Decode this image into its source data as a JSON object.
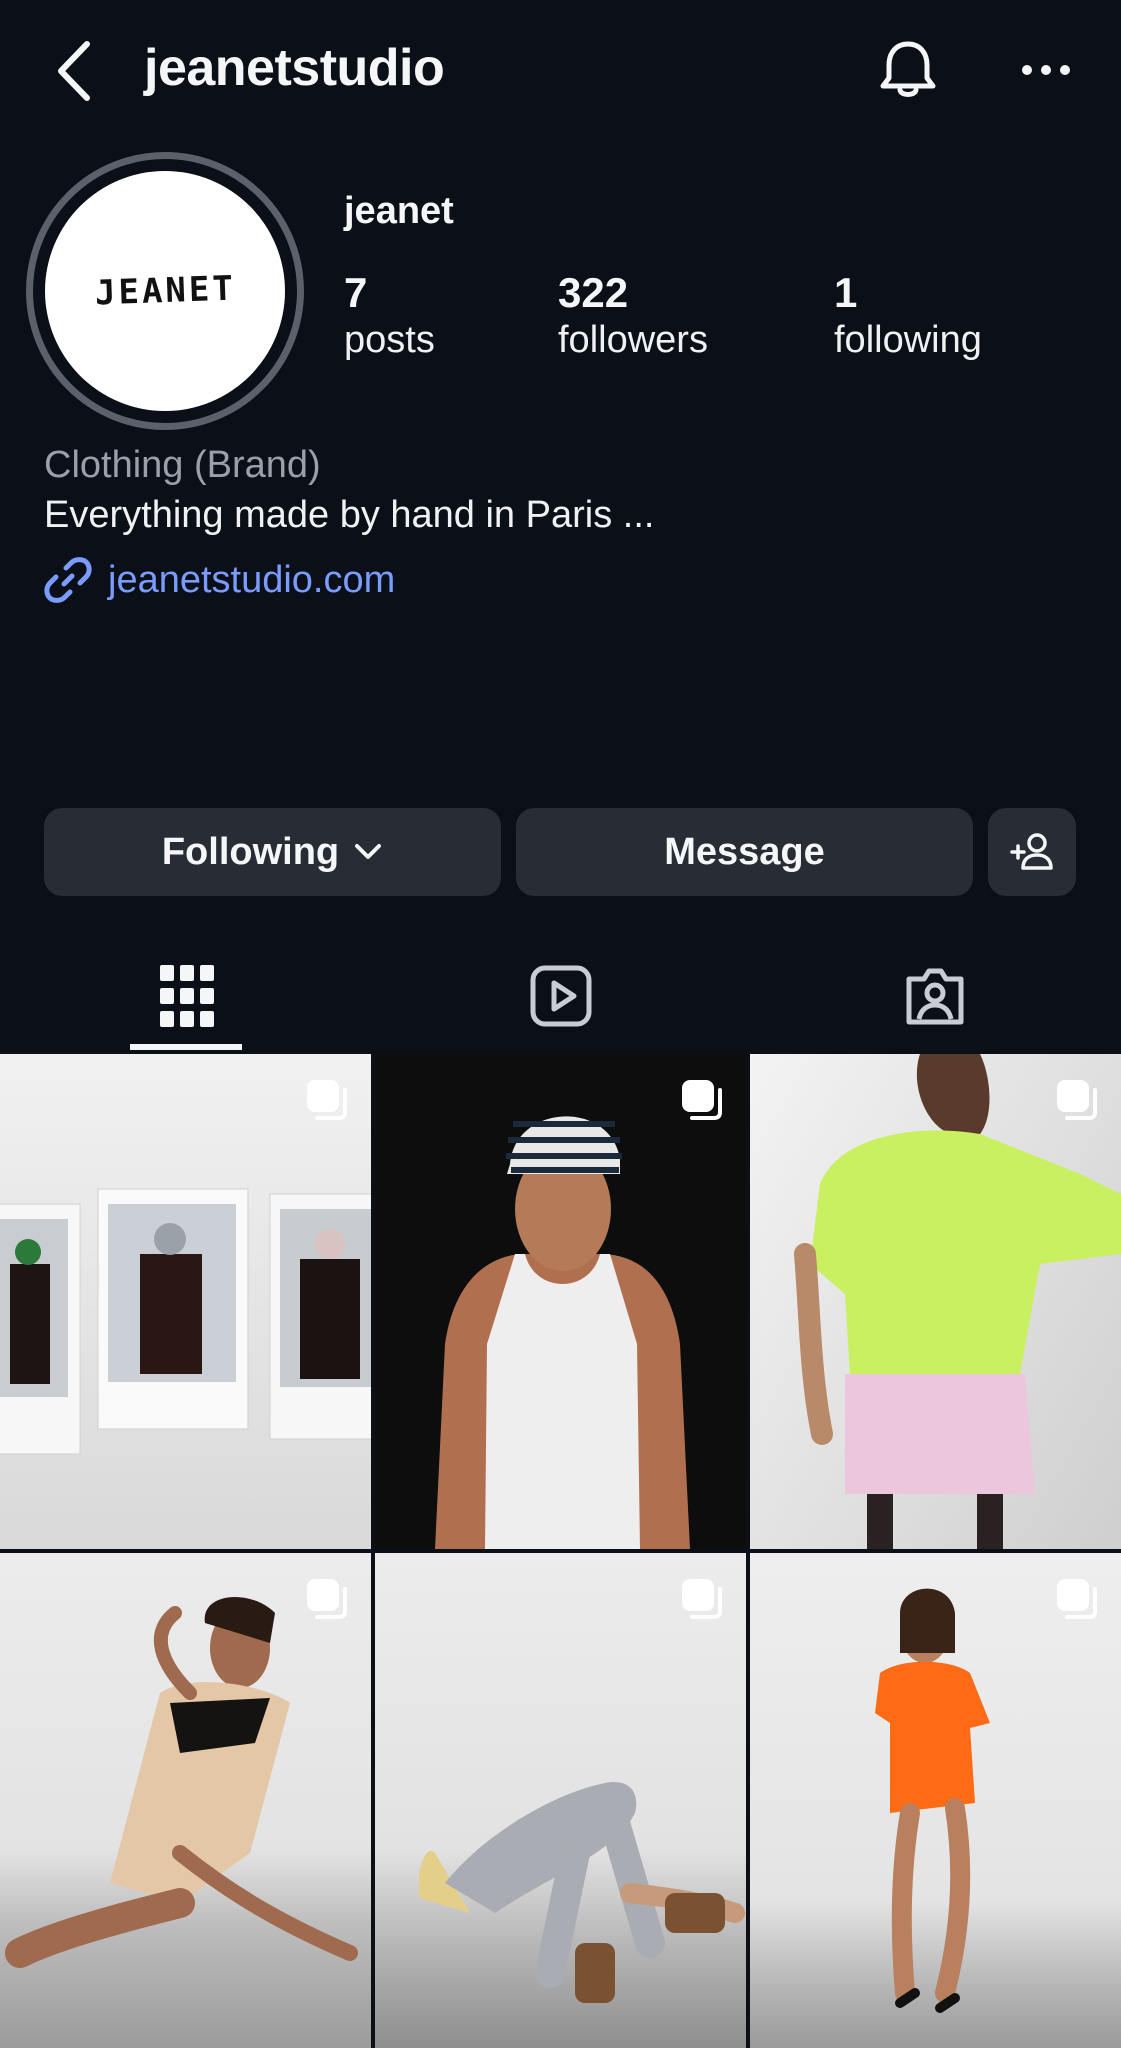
{
  "header": {
    "title": "jeanetstudio",
    "back_icon": "chevron-left-icon",
    "bell_icon": "bell-icon",
    "more_icon": "more-horizontal-icon"
  },
  "profile": {
    "avatar_text": "JEANET",
    "name": "jeanet",
    "stats": [
      {
        "value": "7",
        "label": "posts"
      },
      {
        "value": "322",
        "label": "followers"
      },
      {
        "value": "1",
        "label": "following"
      }
    ],
    "category": "Clothing (Brand)",
    "bio": "Everything made by hand in Paris ...",
    "link": "jeanetstudio.com"
  },
  "actions": {
    "following_label": "Following",
    "message_label": "Message",
    "add_user_icon": "add-person-icon"
  },
  "tabs": [
    {
      "icon": "grid-icon",
      "selected": true
    },
    {
      "icon": "reels-icon",
      "selected": false
    },
    {
      "icon": "tagged-icon",
      "selected": false
    }
  ],
  "posts": [
    {
      "type": "carousel"
    },
    {
      "type": "carousel"
    },
    {
      "type": "carousel"
    },
    {
      "type": "carousel"
    },
    {
      "type": "carousel"
    },
    {
      "type": "carousel"
    }
  ],
  "colors": {
    "background": "#0b0f17",
    "button": "#272c35",
    "link": "#7b9cff",
    "muted": "#9aa0ab"
  }
}
